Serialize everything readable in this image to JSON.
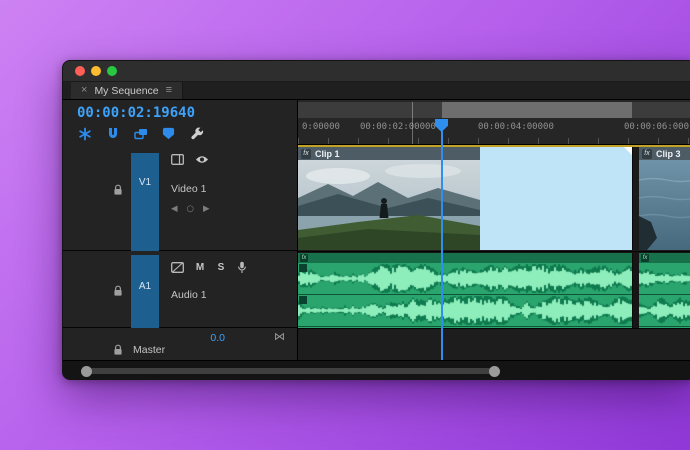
{
  "colors": {
    "accent": "#2f8fee",
    "timecode_blue": "#3da2fa",
    "target_blue": "#1d608f",
    "selection_blue": "#bfe4f8",
    "render_bar": "#c2a226",
    "audio_green": "#2ba56e",
    "waveform_dark": "#0e7a4e",
    "waveform_light": "#8dedbb",
    "traffic_close": "#ff5f57",
    "traffic_min": "#febc2e",
    "traffic_zoom": "#28c840"
  },
  "window": {
    "tab": {
      "close_glyph": "×",
      "title": "My Sequence",
      "menu_glyph": "≡"
    }
  },
  "timecode": "00:00:02:19640",
  "toolbar": {
    "icons": [
      "nest",
      "snap",
      "linked-selection",
      "add-marker",
      "timeline-display-settings"
    ]
  },
  "ruler": {
    "labels": [
      "0:00000",
      "00:00:02:00000",
      "00:00:04:00000",
      "00:00:06:000"
    ]
  },
  "tracks": {
    "video": {
      "target": "V1",
      "name": "Video 1"
    },
    "audio": {
      "target": "A1",
      "name": "Audio 1",
      "mute": "M",
      "solo": "S"
    },
    "master": {
      "name": "Master",
      "volume": "0.0",
      "bowtie_glyph": "⋈"
    }
  },
  "keyframe_nav": {
    "prev": "◀",
    "dot": "○",
    "next": "▶"
  },
  "clips": {
    "video1": {
      "badge": "fx",
      "name": "Clip 1"
    },
    "video3": {
      "badge": "fx",
      "name": "Clip 3"
    },
    "audio1": {
      "badge": "fx"
    },
    "audio2": {
      "badge": "fx"
    }
  }
}
